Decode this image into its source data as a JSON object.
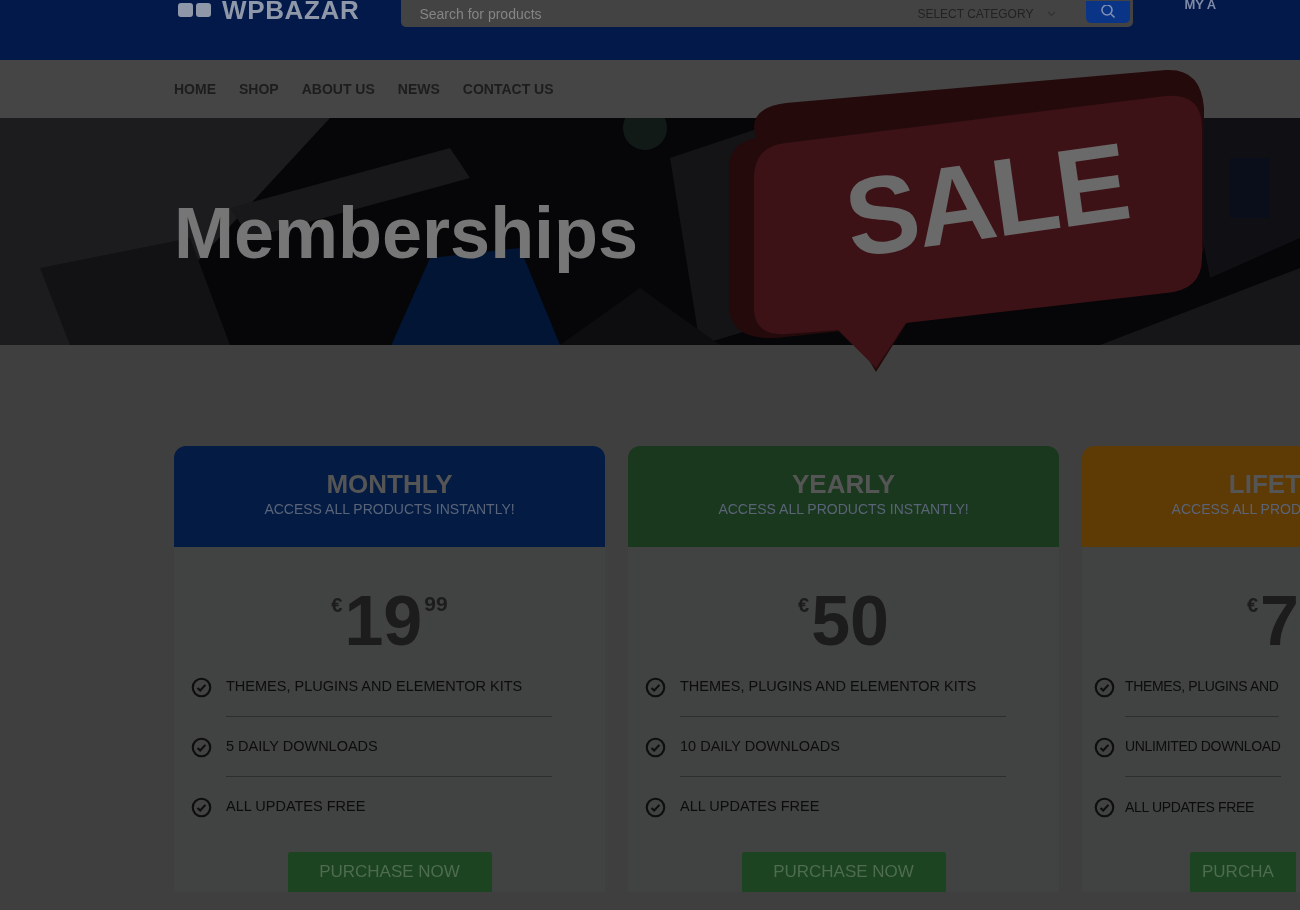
{
  "header": {
    "logo": "WPBAZAR",
    "search": {
      "placeholder": "Search for products"
    },
    "category": "SELECT CATEGORY",
    "account": "MY A"
  },
  "nav": [
    {
      "label": "HOME"
    },
    {
      "label": "SHOP"
    },
    {
      "label": "ABOUT US"
    },
    {
      "label": "NEWS"
    },
    {
      "label": "CONTACT US"
    }
  ],
  "hero": {
    "title": "Memberships",
    "badge": "SALE"
  },
  "plans": [
    {
      "kind": "full",
      "color": "#041c44",
      "title": "MONTHLY",
      "subtitle": "ACCESS ALL PRODUCTS INSTANTLY!",
      "price": {
        "currency": "€",
        "amount": "19",
        "cents": "99"
      },
      "features": [
        "THEMES, PLUGINS AND ELEMENTOR KITS",
        "5 DAILY DOWNLOADS",
        "ALL UPDATES FREE"
      ],
      "button": "PURCHASE NOW"
    },
    {
      "kind": "full",
      "color": "#1a381d",
      "title": "YEARLY",
      "subtitle": "ACCESS ALL PRODUCTS INSTANTLY!",
      "price": {
        "currency": "€",
        "amount": "50"
      },
      "features": [
        "THEMES, PLUGINS AND ELEMENTOR KITS",
        "10 DAILY DOWNLOADS",
        "ALL UPDATES FREE"
      ],
      "button": "PURCHASE NOW"
    },
    {
      "kind": "partial",
      "color": "#5e3a05",
      "title": "LIFET",
      "subtitle": "ACCESS ALL PROD",
      "price": {
        "currency": "€",
        "amount": "7"
      },
      "features": [
        "THEMES, PLUGINS AND",
        "UNLIMITED DOWNLOAD",
        "ALL UPDATES FREE"
      ],
      "button": "PURCHA"
    }
  ]
}
